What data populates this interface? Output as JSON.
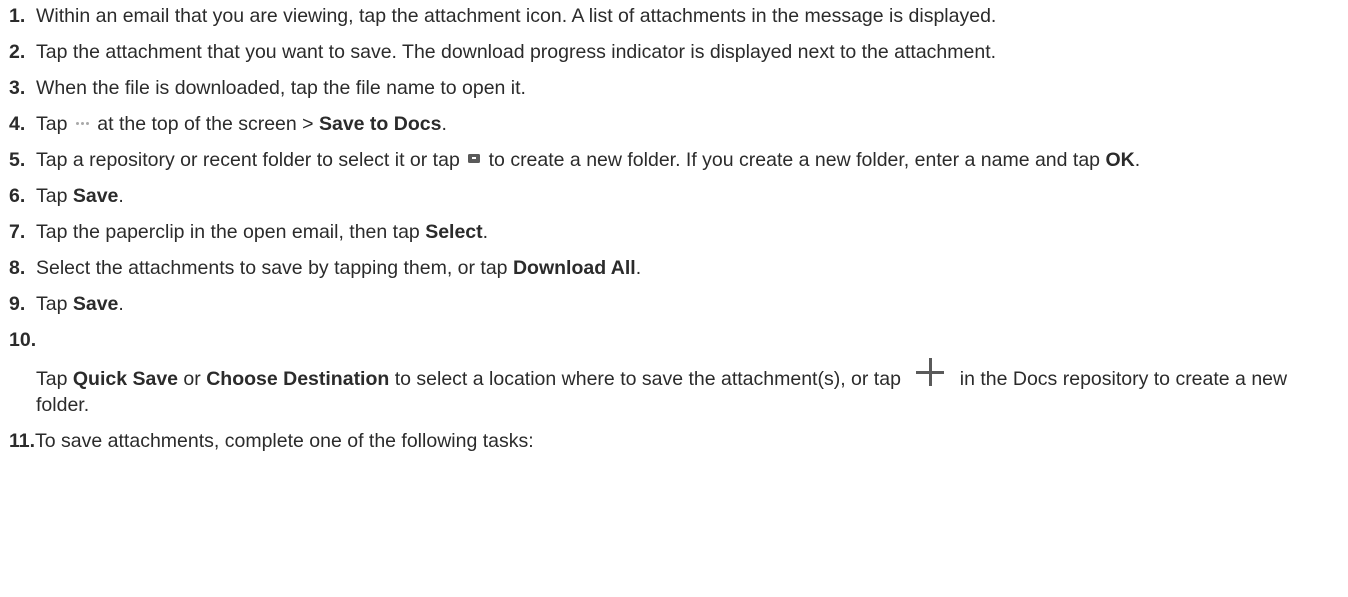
{
  "steps": [
    {
      "num": "1.",
      "parts": [
        {
          "t": "Within an email that you are viewing, tap the attachment icon. A list of attachments in the message is displayed."
        }
      ]
    },
    {
      "num": "2.",
      "parts": [
        {
          "t": "Tap the attachment that you want to save. The download progress indicator is displayed next to the attachment."
        }
      ]
    },
    {
      "num": "3.",
      "parts": [
        {
          "t": "When the file is downloaded, tap the file name to open it."
        }
      ]
    },
    {
      "num": "4.",
      "parts": [
        {
          "t": "Tap "
        },
        {
          "icon": "more-dots-icon"
        },
        {
          "t": " at the top of the screen > "
        },
        {
          "b": "Save to Docs"
        },
        {
          "t": "."
        }
      ]
    },
    {
      "num": "5.",
      "parts": [
        {
          "t": "Tap a repository or recent folder to select it or tap "
        },
        {
          "icon": "new-folder-icon"
        },
        {
          "t": " to create a new folder. If you create a new folder, enter a name and tap "
        },
        {
          "b": "OK"
        },
        {
          "t": "."
        }
      ]
    },
    {
      "num": "6.",
      "parts": [
        {
          "t": "Tap "
        },
        {
          "b": "Save"
        },
        {
          "t": "."
        }
      ]
    },
    {
      "num": "7.",
      "parts": [
        {
          "t": "Tap the paperclip in the open email, then tap "
        },
        {
          "b": "Select"
        },
        {
          "t": "."
        }
      ]
    },
    {
      "num": "8.",
      "parts": [
        {
          "t": "Select the attachments to save by tapping them, or tap "
        },
        {
          "b": "Download All"
        },
        {
          "t": "."
        }
      ]
    },
    {
      "num": "9.",
      "parts": [
        {
          "t": "Tap "
        },
        {
          "b": "Save"
        },
        {
          "t": "."
        }
      ]
    },
    {
      "num": "10.",
      "layout": "block",
      "parts": [
        {
          "t": "Tap "
        },
        {
          "b": "Quick Save"
        },
        {
          "t": " or "
        },
        {
          "b": "Choose Destination"
        },
        {
          "t": " to select a location where to save the attachment(s), or tap "
        },
        {
          "icon": "plus-icon"
        },
        {
          "t": " in the Docs repository to create a new folder."
        }
      ]
    },
    {
      "num": "11.",
      "layout": "tight",
      "parts": [
        {
          "t": "To save attachments, complete one of the following tasks:"
        }
      ]
    }
  ],
  "colors": {
    "text": "#2b2b2b",
    "icon": "#5a5a5a",
    "dots_icon": "#a9a9a9"
  }
}
